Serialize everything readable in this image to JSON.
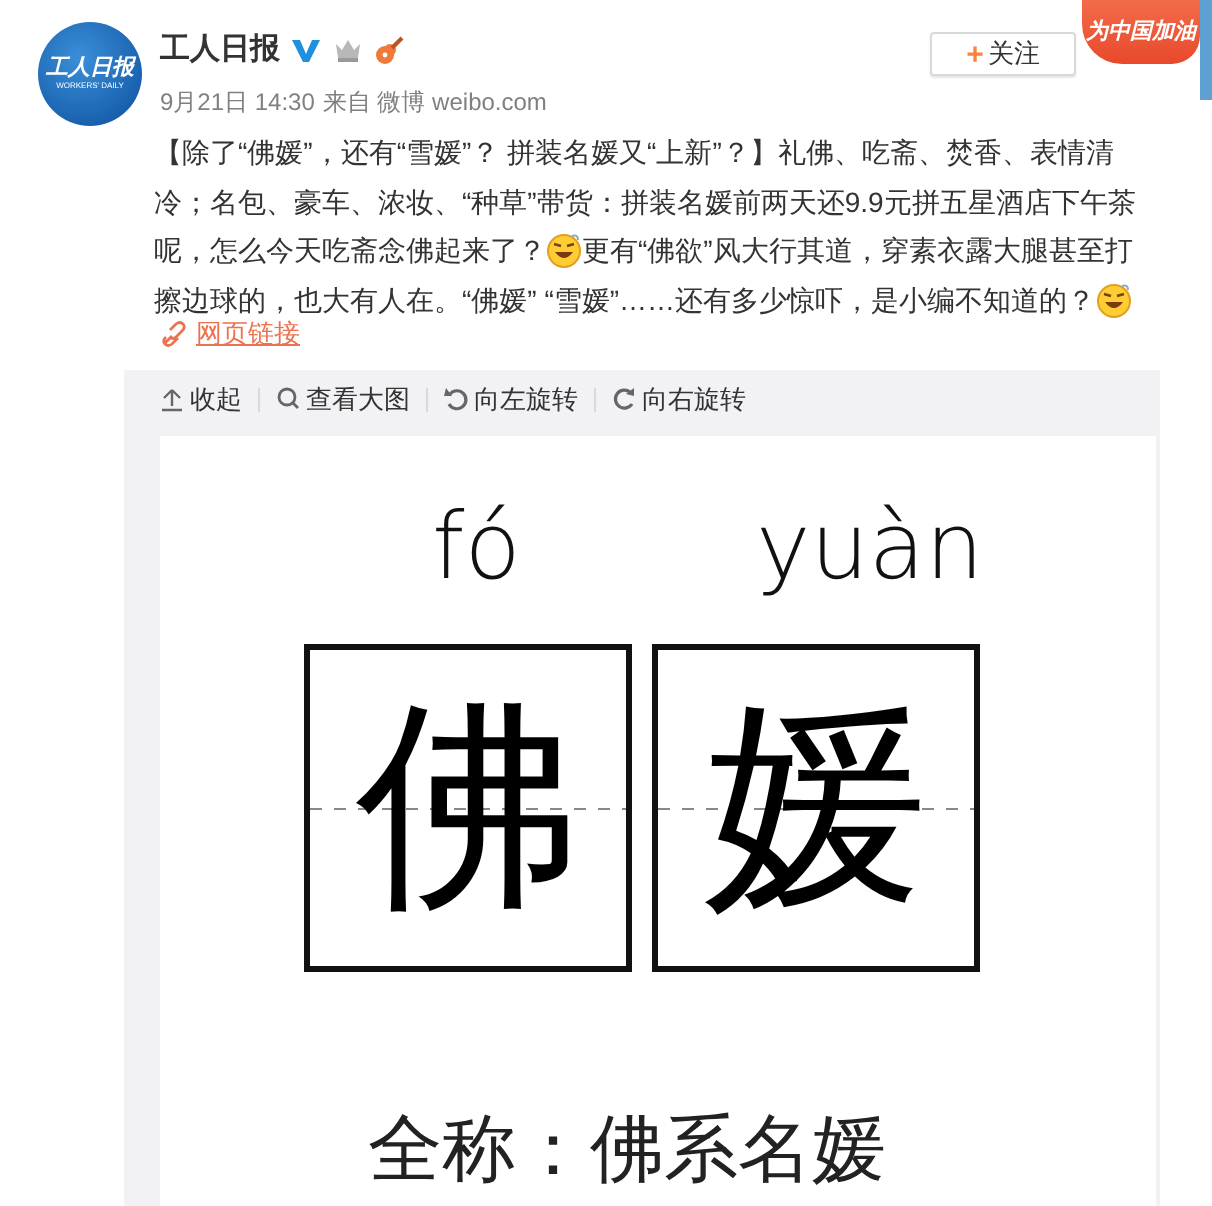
{
  "account": {
    "name": "工人日报",
    "logo_text": "工人日报",
    "logo_subtext": "WORKERS' DAILY",
    "verified": true,
    "time": "9月21日 14:30",
    "source": "来自 微博 weibo.com"
  },
  "follow_button": {
    "icon": "+",
    "label": "关注"
  },
  "banner": {
    "label": "为中国加油"
  },
  "post": {
    "lines": [
      [
        {
          "kind": "text",
          "text": "【除了“佛媛”，还有“雪媛”？ 拼装名媛又“上新”？】礼佛、吃斋、焚香、表情清"
        }
      ],
      [
        {
          "kind": "text",
          "text": "冷；名包、豪车、浓妆、“种草”带货：拼装名媛前两天还9.9元拼五星酒店下午茶"
        }
      ],
      [
        {
          "kind": "text",
          "text": "呢，怎么今天吃斋念佛起来了？"
        },
        {
          "kind": "emoji"
        },
        {
          "kind": "text",
          "text": "更有“佛欲”风大行其道，穿素衣露大腿甚至打"
        }
      ],
      [
        {
          "kind": "text",
          "text": "擦边球的，也大有人在。“佛媛” “雪媛”……还有多少惊吓，是小编不知道的？"
        },
        {
          "kind": "emoji"
        }
      ]
    ],
    "link": "网页链接"
  },
  "toolbar": [
    {
      "kind": "collapse",
      "label": "收起"
    },
    {
      "kind": "zoom",
      "label": "查看大图"
    },
    {
      "kind": "rotate-left",
      "label": "向左旋转"
    },
    {
      "kind": "rotate-right",
      "label": "向右旋转"
    }
  ],
  "image": {
    "pinyin": [
      "fó",
      "yuàn"
    ],
    "characters": [
      "佛",
      "媛"
    ],
    "caption": "全称：佛系名媛"
  }
}
